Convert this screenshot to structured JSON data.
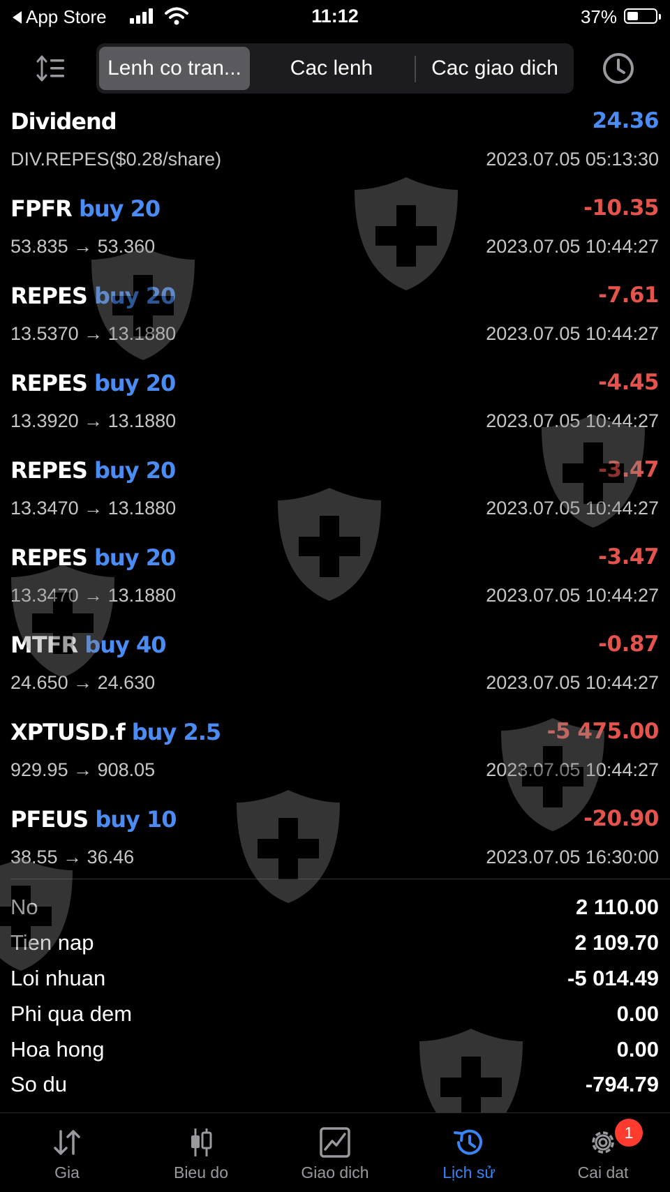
{
  "status_bar": {
    "back_label": "App Store",
    "time": "11:12",
    "battery_percent": "37%"
  },
  "toolbar": {
    "segments": [
      "Lenh co tran...",
      "Cac lenh",
      "Cac giao dich"
    ],
    "active_segment": 0
  },
  "rows": [
    {
      "symbol": "Dividend",
      "side": "",
      "profit": "24.36",
      "profit_sign": "pos",
      "prices": "DIV.REPES($0.28/share)",
      "time": "2023.07.05 05:13:30"
    },
    {
      "symbol": "FPFR",
      "side": "buy 20",
      "profit": "-10.35",
      "profit_sign": "neg",
      "prices": "53.835 → 53.360",
      "time": "2023.07.05 10:44:27"
    },
    {
      "symbol": "REPES",
      "side": "buy 20",
      "profit": "-7.61",
      "profit_sign": "neg",
      "prices": "13.5370 → 13.1880",
      "time": "2023.07.05 10:44:27"
    },
    {
      "symbol": "REPES",
      "side": "buy 20",
      "profit": "-4.45",
      "profit_sign": "neg",
      "prices": "13.3920 → 13.1880",
      "time": "2023.07.05 10:44:27"
    },
    {
      "symbol": "REPES",
      "side": "buy 20",
      "profit": "-3.47",
      "profit_sign": "neg",
      "prices": "13.3470 → 13.1880",
      "time": "2023.07.05 10:44:27"
    },
    {
      "symbol": "REPES",
      "side": "buy 20",
      "profit": "-3.47",
      "profit_sign": "neg",
      "prices": "13.3470 → 13.1880",
      "time": "2023.07.05 10:44:27"
    },
    {
      "symbol": "MTFR",
      "side": "buy 40",
      "profit": "-0.87",
      "profit_sign": "neg",
      "prices": "24.650 → 24.630",
      "time": "2023.07.05 10:44:27"
    },
    {
      "symbol": "XPTUSD.f",
      "side": "buy 2.5",
      "profit": "-5 475.00",
      "profit_sign": "neg",
      "prices": "929.95 → 908.05",
      "time": "2023.07.05 10:44:27"
    },
    {
      "symbol": "PFEUS",
      "side": "buy 10",
      "profit": "-20.90",
      "profit_sign": "neg",
      "prices": "38.55 → 36.46",
      "time": "2023.07.05 16:30:00"
    }
  ],
  "summary": [
    {
      "label": "No",
      "value": "2 110.00"
    },
    {
      "label": "Tien nap",
      "value": "2 109.70"
    },
    {
      "label": "Loi nhuan",
      "value": "-5 014.49"
    },
    {
      "label": "Phi qua dem",
      "value": "0.00"
    },
    {
      "label": "Hoa hong",
      "value": "0.00"
    },
    {
      "label": "So du",
      "value": "-794.79"
    }
  ],
  "tabs": [
    {
      "label": "Gia",
      "icon": "arrows-updown-icon"
    },
    {
      "label": "Bieu do",
      "icon": "candlestick-icon"
    },
    {
      "label": "Giao dich",
      "icon": "chart-line-icon"
    },
    {
      "label": "Lịch sử",
      "icon": "history-icon"
    },
    {
      "label": "Cai dat",
      "icon": "gear-icon"
    }
  ],
  "active_tab": 3,
  "settings_badge": "1",
  "colors": {
    "background": "#000000",
    "accent_blue": "#4a8cf3",
    "negative_red": "#e4544c",
    "badge_red": "#ff3b30"
  }
}
